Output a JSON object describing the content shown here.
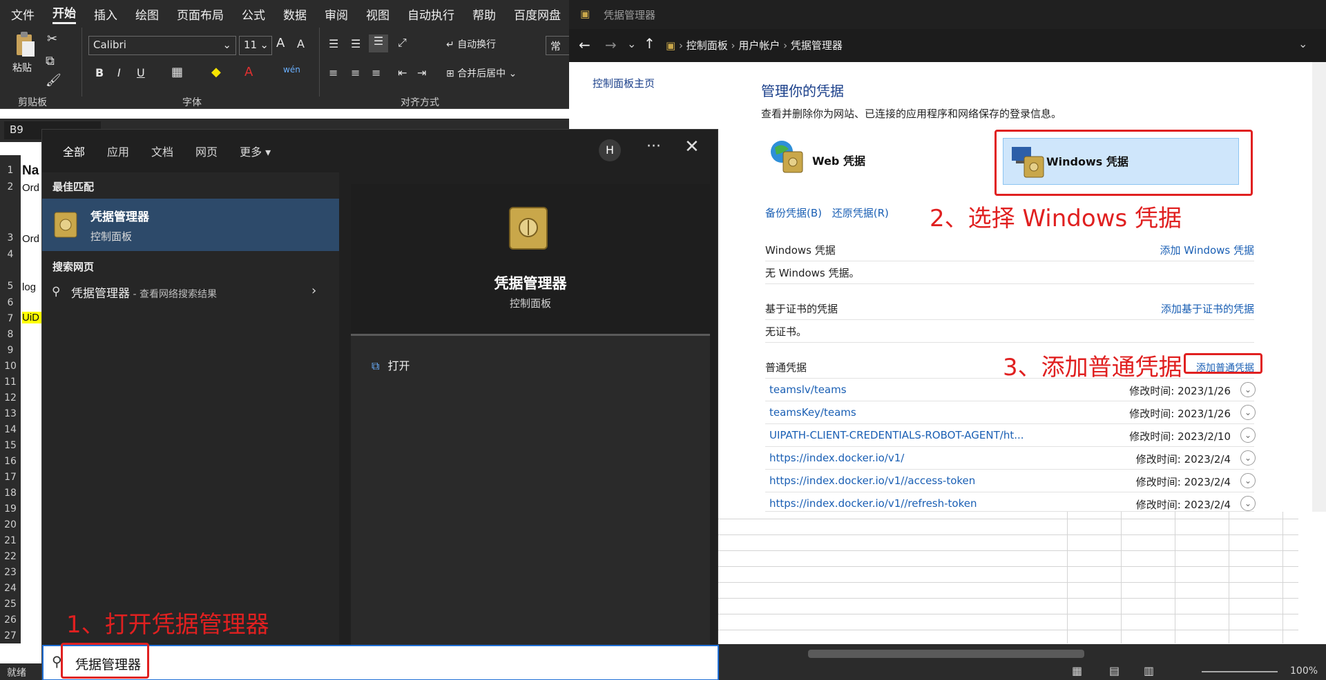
{
  "excel": {
    "menu": [
      "文件",
      "开始",
      "插入",
      "绘图",
      "页面布局",
      "公式",
      "数据",
      "审阅",
      "视图",
      "自动执行",
      "帮助",
      "百度网盘"
    ],
    "ribbon": {
      "paste": "粘贴",
      "clipboard_group": "剪贴板",
      "font_name": "Calibri",
      "font_size": "11",
      "font_group": "字体",
      "align_group": "对齐方式",
      "wrap_text": "自动换行",
      "merge_center": "合并后居中",
      "number_format": "常规",
      "bold": "B",
      "italic": "I",
      "underline": "U",
      "grow_font": "A",
      "shrink_font": "A"
    },
    "name_box": "B9",
    "rows": [
      "1",
      "2",
      "3",
      "4",
      "5",
      "6",
      "7",
      "8",
      "9",
      "10",
      "11",
      "12",
      "13",
      "14",
      "15",
      "16",
      "17",
      "18",
      "19",
      "20",
      "21",
      "22",
      "23",
      "24",
      "25",
      "26",
      "27"
    ],
    "cells": {
      "r1": "Na",
      "r2": "Ord",
      "r3": "Ord",
      "r5": "log",
      "r7": "UiD"
    },
    "status_left": "就绪",
    "zoom": "100%"
  },
  "search": {
    "tabs": [
      "全部",
      "应用",
      "文档",
      "网页",
      "更多"
    ],
    "avatar": "H",
    "best_match_title": "最佳匹配",
    "best_match_name": "凭据管理器",
    "best_match_sub": "控制面板",
    "web_title": "搜索网页",
    "web_query": "凭据管理器",
    "web_suffix": " - 查看网络搜索结果",
    "preview_name": "凭据管理器",
    "preview_sub": "控制面板",
    "open_label": "打开",
    "query": "凭据管理器"
  },
  "cm": {
    "title": "凭据管理器",
    "breadcrumb": [
      "控制面板",
      "用户帐户",
      "凭据管理器"
    ],
    "left_nav": "控制面板主页",
    "heading": "管理你的凭据",
    "description": "查看并删除你为网站、已连接的应用程序和网络保存的登录信息。",
    "web_cred": "Web 凭据",
    "win_cred": "Windows 凭据",
    "backup": "备份凭据(B)",
    "restore": "还原凭据(R)",
    "windows_section": "Windows 凭据",
    "add_windows": "添加 Windows 凭据",
    "no_windows": "无 Windows 凭据。",
    "cert_section": "基于证书的凭据",
    "add_cert": "添加基于证书的凭据",
    "no_cert": "无证书。",
    "generic_section": "普通凭据",
    "add_generic": "添加普通凭据",
    "credentials": [
      {
        "name": "teamslv/teams",
        "modified": "修改时间:  2023/1/26"
      },
      {
        "name": "teamsKey/teams",
        "modified": "修改时间:  2023/1/26"
      },
      {
        "name": "UIPATH-CLIENT-CREDENTIALS-ROBOT-AGENT/ht...",
        "modified": "修改时间:  2023/2/10"
      },
      {
        "name": "https://index.docker.io/v1/",
        "modified": "修改时间:  2023/2/4"
      },
      {
        "name": "https://index.docker.io/v1//access-token",
        "modified": "修改时间:  2023/2/4"
      },
      {
        "name": "https://index.docker.io/v1//refresh-token",
        "modified": "修改时间:  2023/2/4"
      }
    ]
  },
  "annotations": {
    "step1": "1、打开凭据管理器",
    "step2": "2、选择 Windows 凭据",
    "step3": "3、添加普通凭据"
  },
  "colors": {
    "annotation": "#e02020",
    "link": "#1a5fb4",
    "accent": "#4cc2ff",
    "selected": "#2d4a6a"
  }
}
